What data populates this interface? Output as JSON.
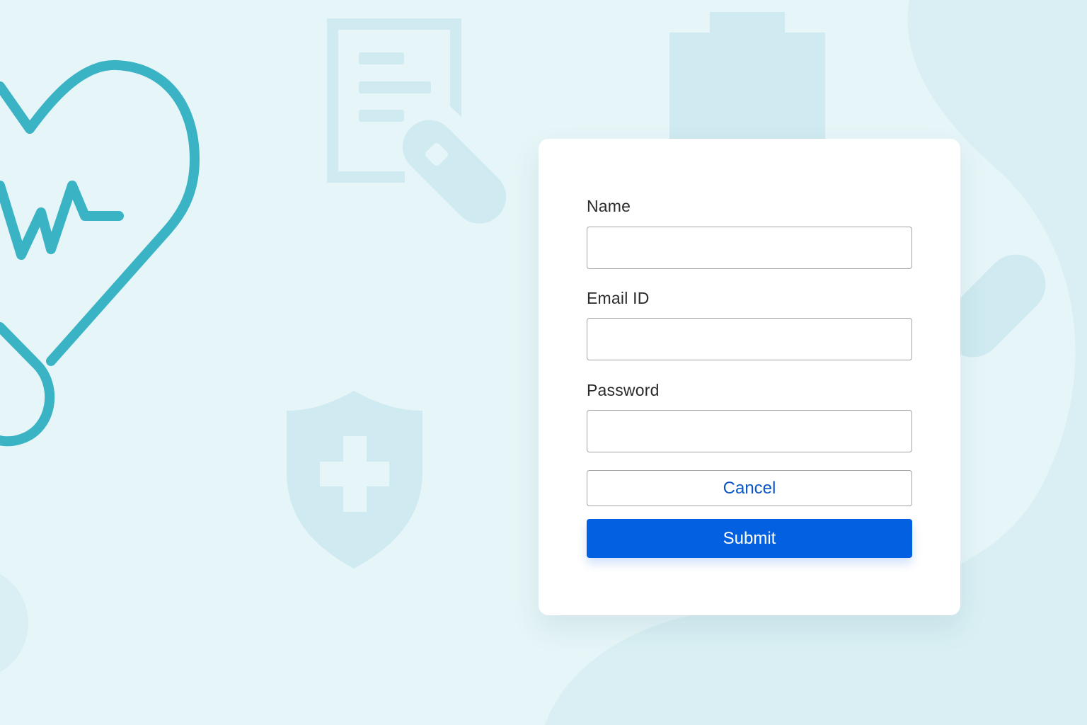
{
  "form": {
    "name_label": "Name",
    "name_value": "",
    "email_label": "Email ID",
    "email_value": "",
    "password_label": "Password",
    "password_value": "",
    "cancel_label": "Cancel",
    "submit_label": "Submit"
  },
  "theme": {
    "background": "#e6f5f7",
    "accent": "#3ab3c4",
    "faded_icon": "#cfeaf0",
    "primary_button": "#0360e0",
    "link_text": "#0a56c6"
  },
  "icons": [
    "heart-pulse-icon",
    "clipboard-pill-icon",
    "medicine-bottle-icon",
    "shield-cross-icon",
    "capsule-icon"
  ]
}
